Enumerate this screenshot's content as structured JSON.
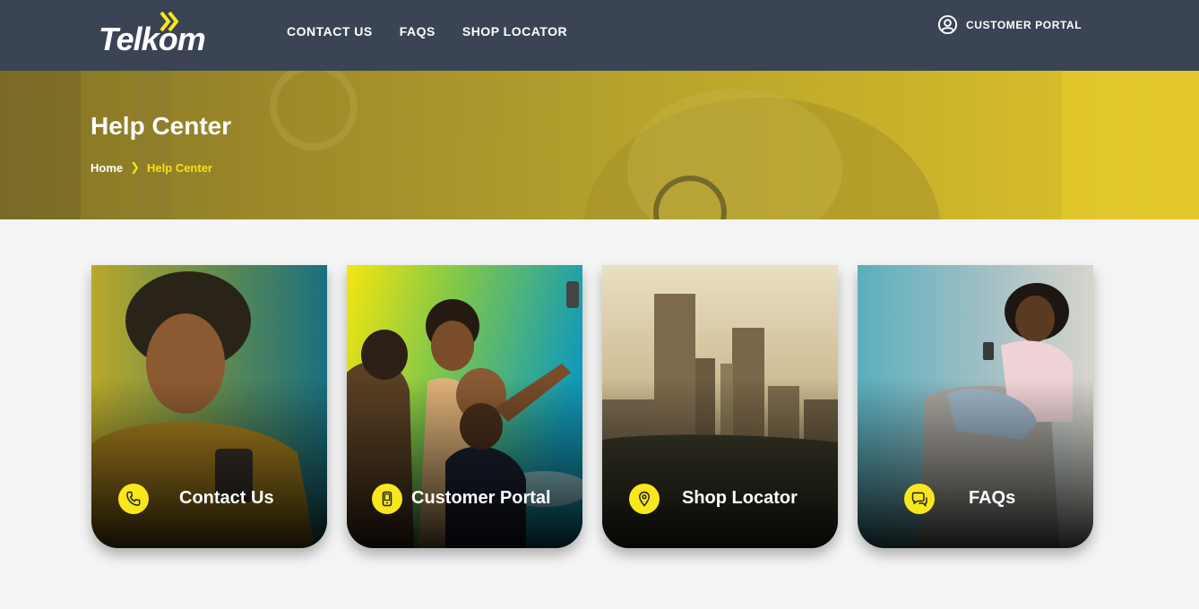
{
  "header": {
    "logo_text": "Telkom",
    "nav": [
      "CONTACT US",
      "FAQS",
      "SHOP LOCATOR"
    ],
    "portal_label": "CUSTOMER PORTAL",
    "portal_icon": "user-circle-icon",
    "background": "#3b4454"
  },
  "hero": {
    "title": "Help Center",
    "breadcrumb": {
      "home": "Home",
      "separator_icon": "chevron-right-icon",
      "current": "Help Center"
    }
  },
  "cards": [
    {
      "label": "Contact Us",
      "icon": "phone-icon"
    },
    {
      "label": "Customer Portal",
      "icon": "mobile-phone-icon"
    },
    {
      "label": "Shop Locator",
      "icon": "map-pin-icon"
    },
    {
      "label": "FAQs",
      "icon": "chat-bubble-icon"
    }
  ],
  "colors": {
    "accent": "#f8e71c",
    "page_background": "#f4f4f4",
    "text_light": "#ffffff"
  }
}
